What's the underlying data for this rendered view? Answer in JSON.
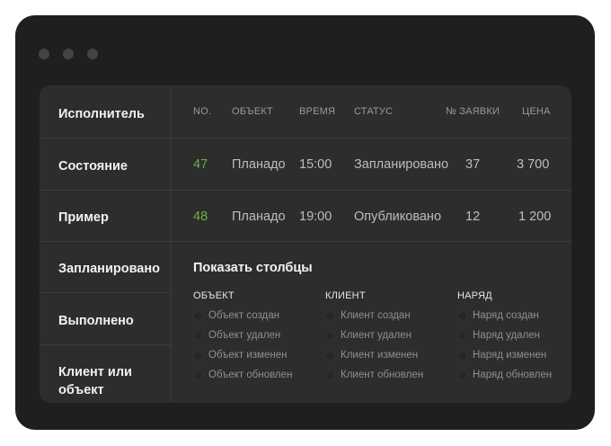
{
  "sidebar": {
    "items": [
      {
        "label": "Исполнитель"
      },
      {
        "label": "Состояние"
      },
      {
        "label": "Пример"
      },
      {
        "label": "Запланировано"
      },
      {
        "label": "Выполнено"
      },
      {
        "label": "Клиент или объект"
      }
    ]
  },
  "table": {
    "headers": [
      "NO.",
      "ОБЪЕКТ",
      "ВРЕМЯ",
      "СТАТУС",
      "№ ЗАЯВКИ",
      "ЦЕНА"
    ],
    "rows": [
      {
        "no": "47",
        "object": "Планадо",
        "time": "15:00",
        "status": "Запланировано",
        "request": "37",
        "price": "3 700"
      },
      {
        "no": "48",
        "object": "Планадо",
        "time": "19:00",
        "status": "Опубликовано",
        "request": "12",
        "price": "1 200"
      }
    ]
  },
  "columns_panel": {
    "title": "Показать столбцы",
    "groups": [
      {
        "title": "ОБЪЕКТ",
        "options": [
          "Объект создан",
          "Объект удален",
          "Объект изменен",
          "Объект обновлен"
        ]
      },
      {
        "title": "КЛИЕНТ",
        "options": [
          "Клиент создан",
          "Клиент удален",
          "Клиент изменен",
          "Клиент обновлен"
        ]
      },
      {
        "title": "НАРЯД",
        "options": [
          "Наряд создан",
          "Наряд удален",
          "Наряд изменен",
          "Наряд обновлен"
        ]
      }
    ]
  },
  "colors": {
    "accent_number": "#67b043",
    "window_bg": "#1f1f1f",
    "panel_bg": "#2d2d2d"
  }
}
